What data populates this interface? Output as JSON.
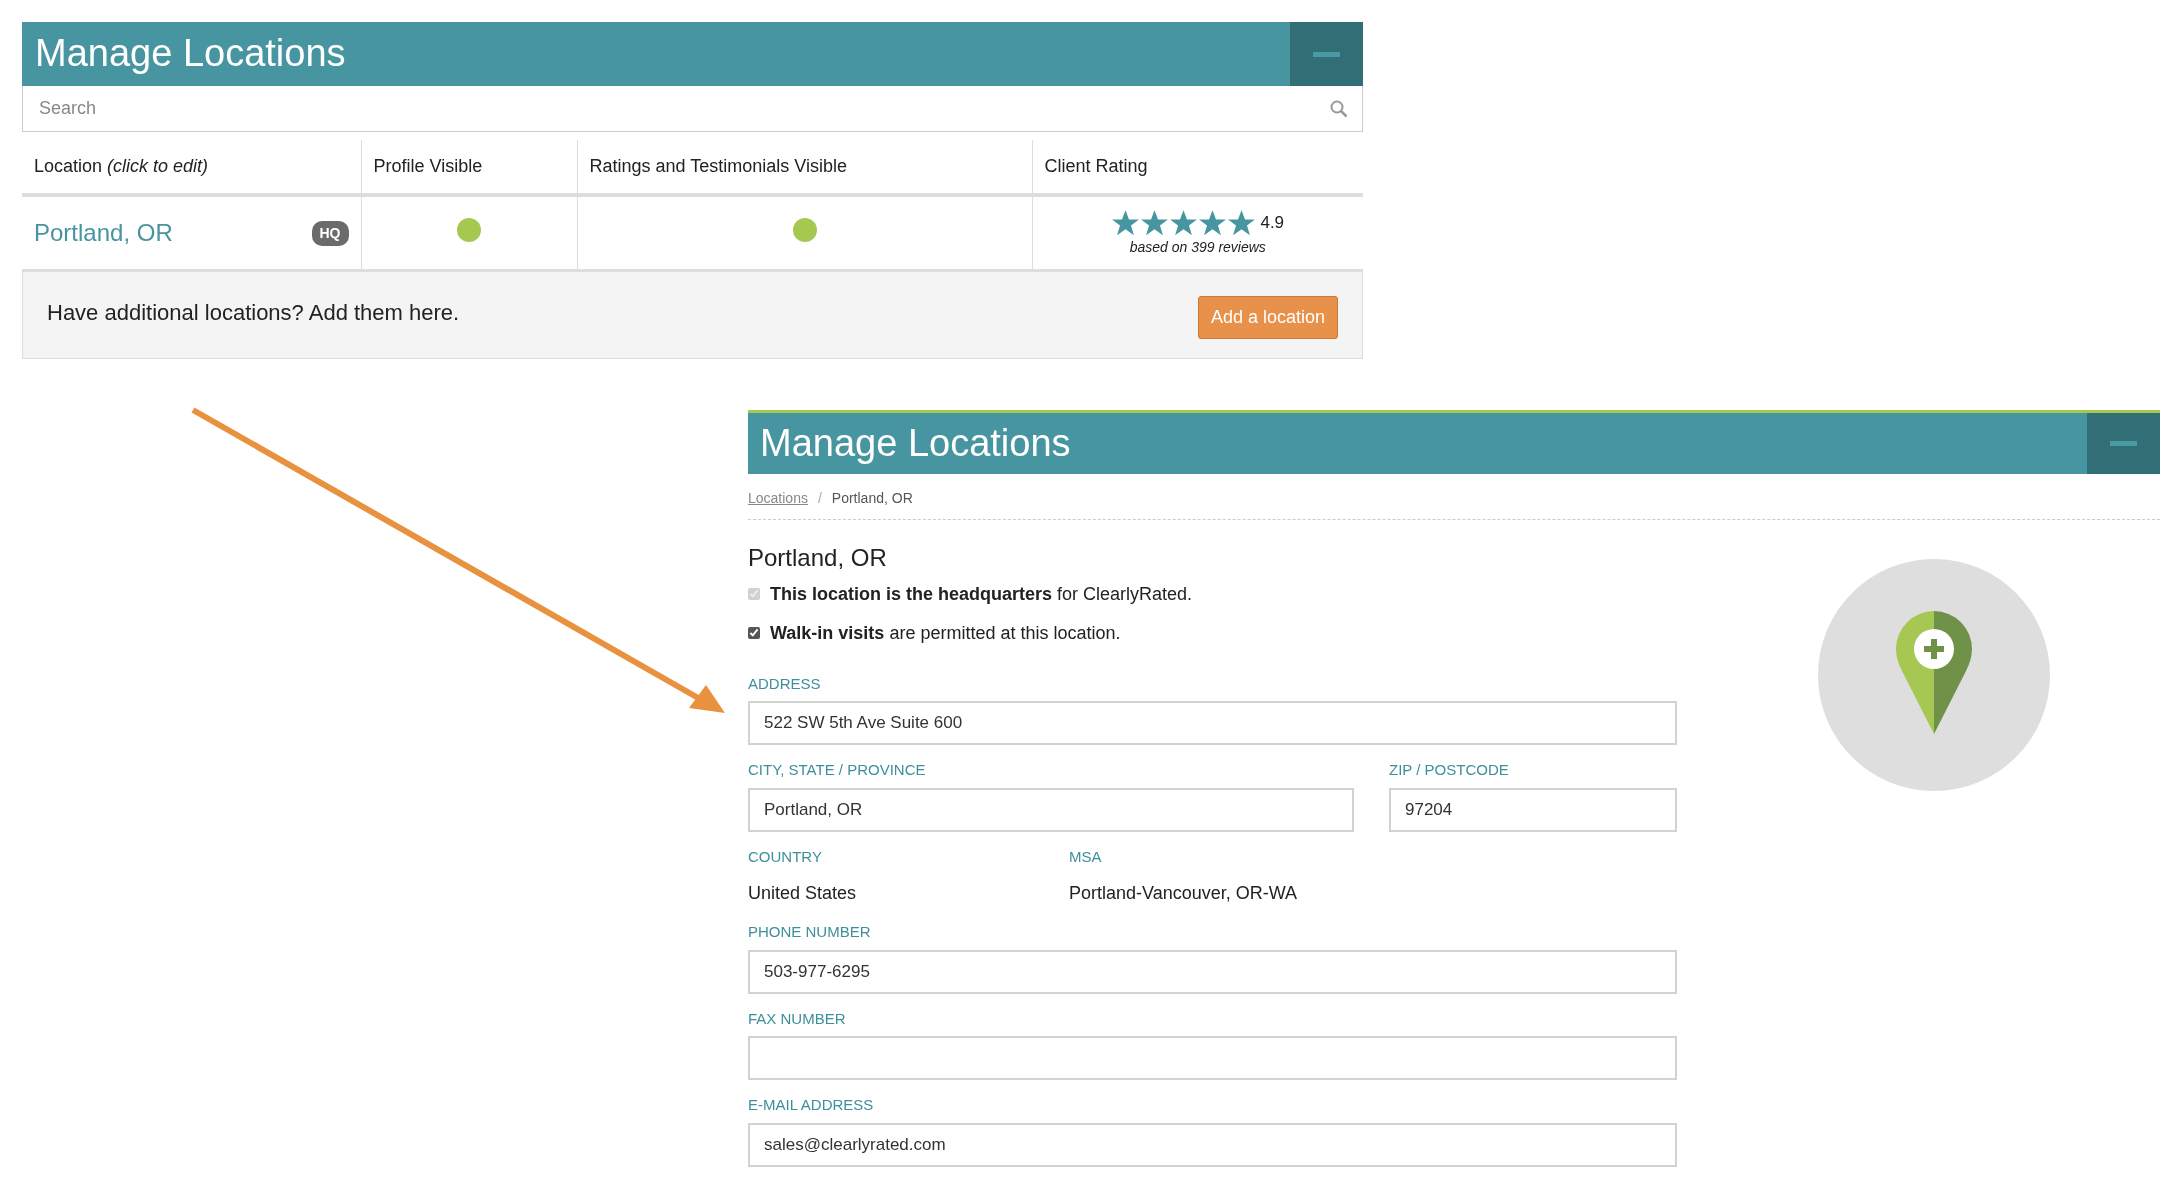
{
  "list_panel": {
    "title": "Manage Locations",
    "search": {
      "placeholder": "Search"
    },
    "table": {
      "columns": [
        "Location *(click to edit)*",
        "Profile Visible",
        "Ratings and Testimonials Visible",
        "Client Rating"
      ],
      "rows": [
        {
          "location": "Portland, OR",
          "badge": "HQ",
          "profile_visible": true,
          "ratings_visible": true,
          "stars": 5,
          "rating": "4.9",
          "reviews": "based on 399 reviews"
        }
      ]
    },
    "footer": {
      "text": "Have additional locations? Add them here.",
      "button": "Add a location"
    }
  },
  "edit_panel": {
    "title": "Manage Locations",
    "breadcrumb": [
      {
        "label": "Locations",
        "link": true
      },
      {
        "label": "Portland, OR",
        "link": false
      }
    ],
    "breadcrumb_separator": "/",
    "heading": "Portland, OR",
    "checkboxes": [
      {
        "text": "**This location is the headquarters** for ClearlyRated.",
        "checked": true,
        "disabled": true
      },
      {
        "text": "**Walk-in visits** are permitted at this location.",
        "checked": true,
        "disabled": false
      }
    ],
    "field_rows": [
      [
        {
          "kind": "input",
          "label": "ADDRESS",
          "value": "522 SW 5th Ave Suite 600"
        }
      ],
      [
        {
          "kind": "input",
          "label": "CITY, STATE / PROVINCE",
          "value": "Portland, OR"
        },
        {
          "kind": "input",
          "label": "ZIP / POSTCODE",
          "value": "97204"
        }
      ],
      [
        {
          "kind": "static",
          "label": "COUNTRY",
          "value": "United States"
        },
        {
          "kind": "static",
          "label": "MSA",
          "value": "Portland-Vancouver, OR-WA"
        }
      ],
      [
        {
          "kind": "input",
          "label": "PHONE NUMBER",
          "value": "503-977-6295"
        }
      ],
      [
        {
          "kind": "input",
          "label": "FAX NUMBER"
        }
      ],
      [
        {
          "kind": "input",
          "label": "E-MAIL ADDRESS",
          "value": "sales@clearlyrated.com"
        }
      ]
    ]
  }
}
